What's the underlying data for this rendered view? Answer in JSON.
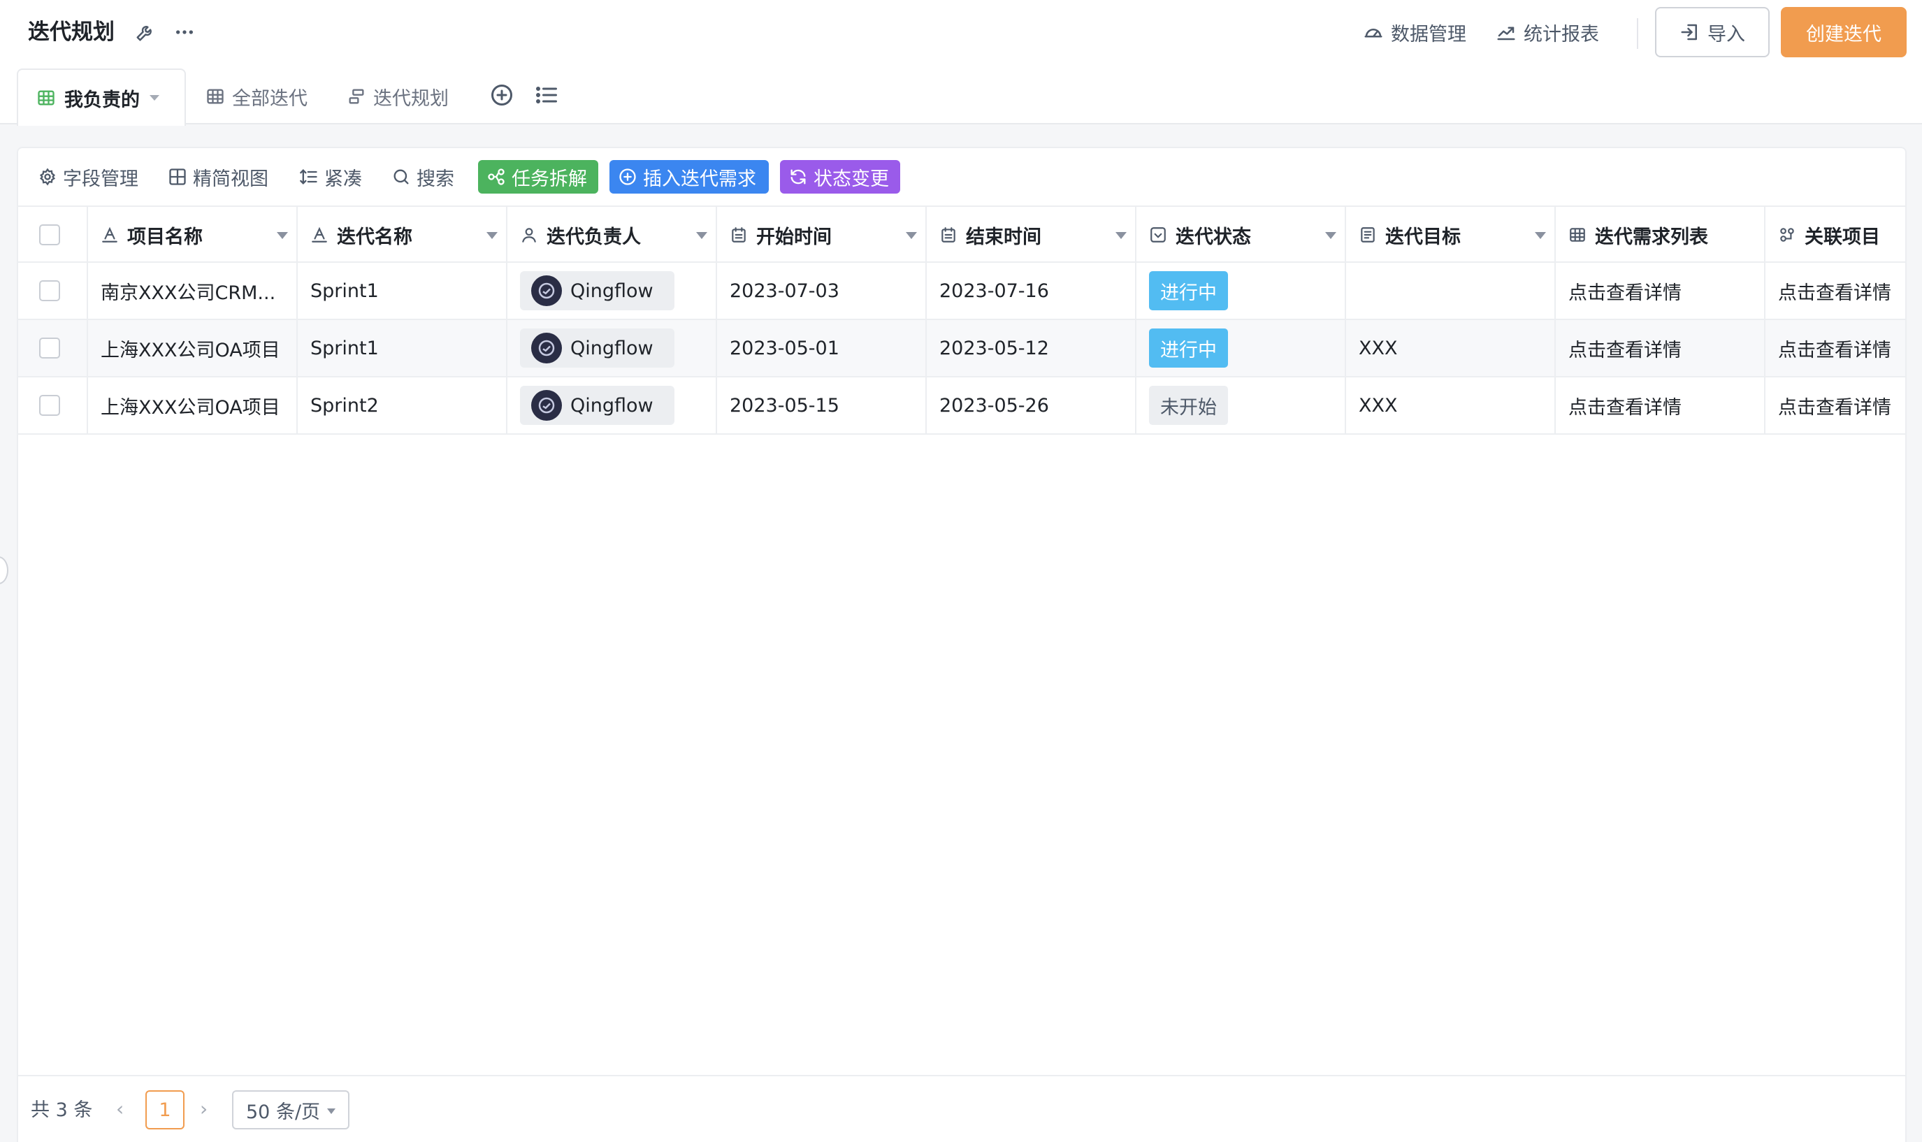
{
  "header": {
    "title": "迭代规划",
    "links": [
      "数据管理",
      "统计报表"
    ],
    "import_label": "导入",
    "create_label": "创建迭代"
  },
  "tabs": {
    "active": "我负责的",
    "others": [
      "全部迭代",
      "迭代规划"
    ]
  },
  "toolbar": {
    "field_mgmt": "字段管理",
    "simple_view": "精简视图",
    "compact": "紧凑",
    "search": "搜索",
    "task_split": "任务拆解",
    "insert_req": "插入迭代需求",
    "status_change": "状态变更"
  },
  "colors": {
    "accent": "#f19c4f",
    "task_split": "#4cb35e",
    "insert_req": "#3b86f0",
    "status_change": "#9a5bea",
    "status_active": "#52bcf2"
  },
  "table": {
    "columns": [
      "项目名称",
      "迭代名称",
      "迭代负责人",
      "开始时间",
      "结束时间",
      "迭代状态",
      "迭代目标",
      "迭代需求列表",
      "关联项目"
    ],
    "rows": [
      {
        "project": "南京XXX公司CRM...",
        "sprint": "Sprint1",
        "owner": "Qingflow",
        "start": "2023-07-03",
        "end": "2023-07-16",
        "status": "进行中",
        "goal": "",
        "req_list": "点击查看详情",
        "related": "点击查看详情"
      },
      {
        "project": "上海XXX公司OA项目",
        "sprint": "Sprint1",
        "owner": "Qingflow",
        "start": "2023-05-01",
        "end": "2023-05-12",
        "status": "进行中",
        "goal": "XXX",
        "req_list": "点击查看详情",
        "related": "点击查看详情"
      },
      {
        "project": "上海XXX公司OA项目",
        "sprint": "Sprint2",
        "owner": "Qingflow",
        "start": "2023-05-15",
        "end": "2023-05-26",
        "status": "未开始",
        "goal": "XXX",
        "req_list": "点击查看详情",
        "related": "点击查看详情"
      }
    ]
  },
  "pagination": {
    "total": "共 3 条",
    "current": "1",
    "page_size": "50 条/页"
  }
}
